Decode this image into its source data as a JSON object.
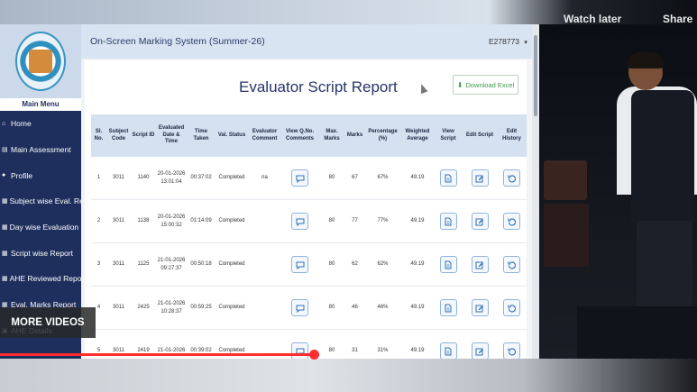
{
  "video": {
    "watch_later": "Watch later",
    "share": "Share",
    "more_videos": "MORE VIDEOS",
    "progress_fraction": 0.45
  },
  "app": {
    "title": "On-Screen Marking System (Summer-26)",
    "user_id": "E278773",
    "user_caret": "▾"
  },
  "sidebar": {
    "main_menu": "Main Menu",
    "items": [
      {
        "label": "Home",
        "icon": "home-icon"
      },
      {
        "label": "Main Assessment",
        "icon": "assessment-icon"
      },
      {
        "label": "Profile",
        "icon": "profile-icon"
      },
      {
        "label": "Subject wise Eval. Report",
        "icon": "report-icon"
      },
      {
        "label": "Day wise Evaluation Report",
        "icon": "report-icon"
      },
      {
        "label": "Script wise Report",
        "icon": "report-icon"
      },
      {
        "label": "AHE Reviewed Report",
        "icon": "report-icon"
      },
      {
        "label": "Eval. Marks Report",
        "icon": "report-icon"
      },
      {
        "label": "AHE Details",
        "icon": "details-icon"
      }
    ]
  },
  "report": {
    "title": "Evaluator Script Report",
    "download_excel": "Download Excel",
    "columns": [
      "Sl. No.",
      "Subject Code",
      "Script ID",
      "Evaluated Date & Time",
      "Time Taken",
      "Val. Status",
      "Evaluator Comment",
      "View Q.No. Comments",
      "Max. Marks",
      "Marks",
      "Percentage (%)",
      "Weighted Average",
      "View Script",
      "Edit Script",
      "Edit History"
    ],
    "rows": [
      {
        "sl": "1",
        "subject": "3011",
        "script": "1140",
        "date": "20-01-2026 13:01:04",
        "time": "00:37:02",
        "status": "Completed",
        "comment": "na",
        "max": "80",
        "marks": "67",
        "pct": "67%",
        "wavg": "49.19"
      },
      {
        "sl": "2",
        "subject": "3011",
        "script": "1138",
        "date": "20-01-2026 15:00:32",
        "time": "01:14:09",
        "status": "Completed",
        "comment": "",
        "max": "80",
        "marks": "77",
        "pct": "77%",
        "wavg": "49.19"
      },
      {
        "sl": "3",
        "subject": "3011",
        "script": "1125",
        "date": "21-01-2026 09:27:37",
        "time": "00:50:18",
        "status": "Completed",
        "comment": "",
        "max": "80",
        "marks": "62",
        "pct": "62%",
        "wavg": "49.19"
      },
      {
        "sl": "4",
        "subject": "3011",
        "script": "2425",
        "date": "21-01-2026 10:28:37",
        "time": "00:59:25",
        "status": "Completed",
        "comment": "",
        "max": "80",
        "marks": "46",
        "pct": "46%",
        "wavg": "49.19"
      },
      {
        "sl": "5",
        "subject": "3011",
        "script": "2419",
        "date": "21-01-2026",
        "time": "00:39:02",
        "status": "Completed",
        "comment": "",
        "max": "80",
        "marks": "31",
        "pct": "31%",
        "wavg": "49.19"
      }
    ]
  },
  "colors": {
    "sidebar_bg": "#1f2f5d",
    "header_bg": "#d3e1f0",
    "accent_blue": "#2f6fb3",
    "excel_green": "#3a9a4d",
    "progress_red": "#ff2d2d"
  }
}
